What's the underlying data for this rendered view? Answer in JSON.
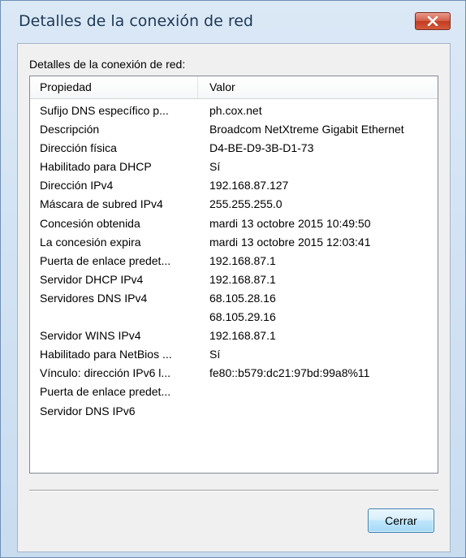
{
  "window": {
    "title": "Detalles de la conexión de red",
    "close_icon": "close-x-icon",
    "accent_close": "#c94a30"
  },
  "group_label": "Detalles de la conexión de red:",
  "listview": {
    "columns": [
      "Propiedad",
      "Valor"
    ],
    "rows": [
      {
        "property": "Sufijo DNS específico p...",
        "value": "ph.cox.net"
      },
      {
        "property": "Descripción",
        "value": "Broadcom NetXtreme Gigabit Ethernet"
      },
      {
        "property": "Dirección física",
        "value": "D4-BE-D9-3B-D1-73"
      },
      {
        "property": "Habilitado para DHCP",
        "value": "Sí"
      },
      {
        "property": "Dirección IPv4",
        "value": "192.168.87.127"
      },
      {
        "property": "Máscara de subred IPv4",
        "value": "255.255.255.0"
      },
      {
        "property": "Concesión obtenida",
        "value": "mardi 13 octobre 2015 10:49:50"
      },
      {
        "property": "La concesión expira",
        "value": "mardi 13 octobre 2015 12:03:41"
      },
      {
        "property": "Puerta de enlace predet...",
        "value": "192.168.87.1"
      },
      {
        "property": "Servidor DHCP IPv4",
        "value": "192.168.87.1"
      },
      {
        "property": "Servidores DNS IPv4",
        "value": "68.105.28.16"
      },
      {
        "property": "",
        "value": "68.105.29.16"
      },
      {
        "property": "Servidor WINS IPv4",
        "value": "192.168.87.1"
      },
      {
        "property": "Habilitado para NetBios ...",
        "value": "Sí"
      },
      {
        "property": "Vínculo: dirección IPv6 l...",
        "value": "fe80::b579:dc21:97bd:99a8%11"
      },
      {
        "property": "Puerta de enlace predet...",
        "value": ""
      },
      {
        "property": "Servidor DNS IPv6",
        "value": ""
      }
    ]
  },
  "buttons": {
    "close_label": "Cerrar"
  }
}
